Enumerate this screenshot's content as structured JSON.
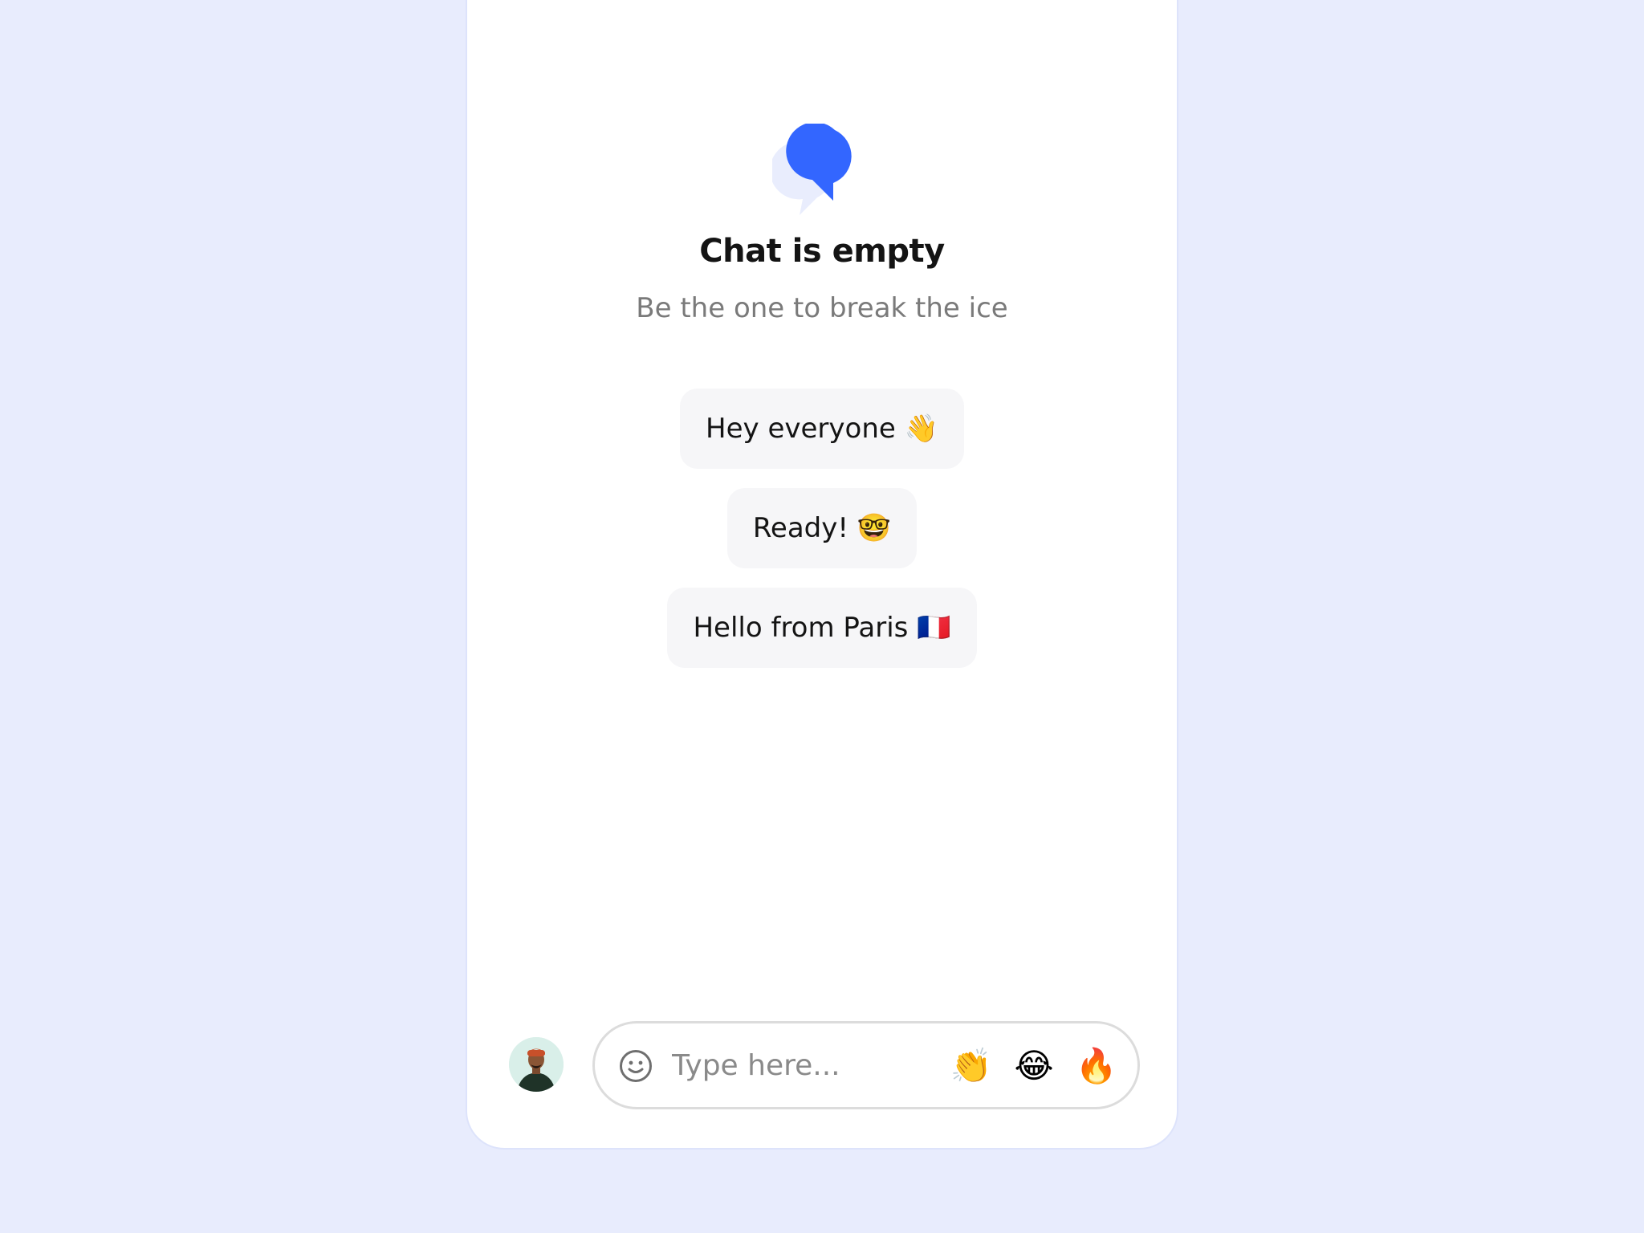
{
  "empty_state": {
    "title": "Chat is empty",
    "subtitle": "Be the one to break the ice"
  },
  "suggestions": [
    {
      "label": "Hey everyone 👋"
    },
    {
      "label": "Ready! 🤓"
    },
    {
      "label": "Hello from Paris 🇫🇷"
    }
  ],
  "composer": {
    "placeholder": "Type here...",
    "quick_reactions": [
      "👏",
      "😂",
      "🔥"
    ]
  },
  "colors": {
    "accent": "#3366ff",
    "accent_light": "#e9edfd",
    "background": "#e8ecfd"
  },
  "icons": {
    "logo": "chat-bubbles-icon",
    "emoji_picker": "smiley-icon"
  }
}
